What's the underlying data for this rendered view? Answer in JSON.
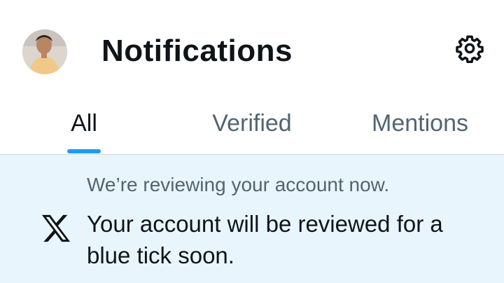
{
  "header": {
    "title": "Notifications",
    "avatar_icon": "user-avatar",
    "settings_icon": "gear-icon"
  },
  "tabs": [
    {
      "label": "All",
      "active": true
    },
    {
      "label": "Verified",
      "active": false
    },
    {
      "label": "Mentions",
      "active": false
    }
  ],
  "notification": {
    "icon": "x-logo-icon",
    "subtitle": "We’re reviewing your account now.",
    "message": "Your account will be reviewed for a blue tick soon."
  },
  "colors": {
    "accent": "#1d9bf0",
    "notice_background": "#e8f5fd",
    "primary_text": "#0f1419",
    "secondary_text": "#536471"
  }
}
